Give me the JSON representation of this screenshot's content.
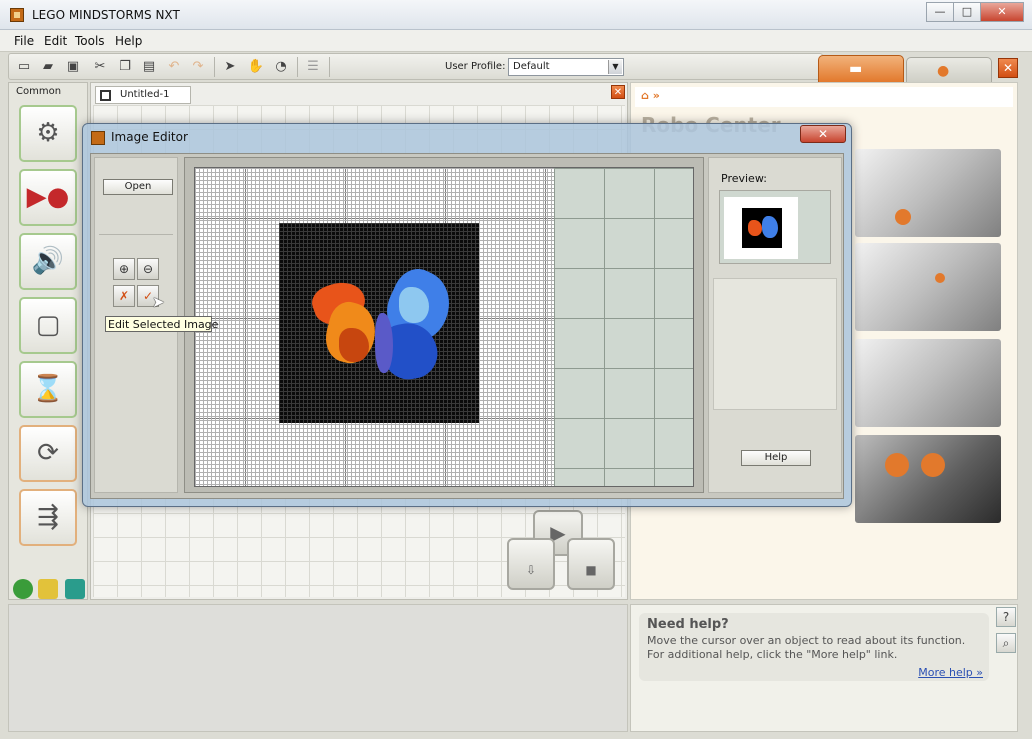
{
  "window": {
    "title": "LEGO MINDSTORMS NXT",
    "min": "—",
    "max": "□",
    "close": "✕"
  },
  "menu": [
    "File",
    "Edit",
    "Tools",
    "Help"
  ],
  "toolbar": {
    "profile_label": "User Profile:",
    "profile_value": "Default"
  },
  "palette": {
    "title": "Common"
  },
  "document": {
    "tab_label": "Untitled-1"
  },
  "dialog": {
    "title": "Image Editor",
    "open_label": "Open",
    "tooltip": "Edit Selected Image",
    "preview_label": "Preview:",
    "help_label": "Help"
  },
  "robo": {
    "title": "Robo Center",
    "breadcrumb": "»"
  },
  "help": {
    "title": "Need help?",
    "body": "Move the cursor over an object to read about its function. For additional help, click the \"More help\" link.",
    "link": "More help »"
  },
  "colors": {
    "accent": "#e2792c",
    "pixel_bg": "#0b0b0b",
    "wing_warm": "#e8541a",
    "wing_cool": "#3f7fe8"
  }
}
